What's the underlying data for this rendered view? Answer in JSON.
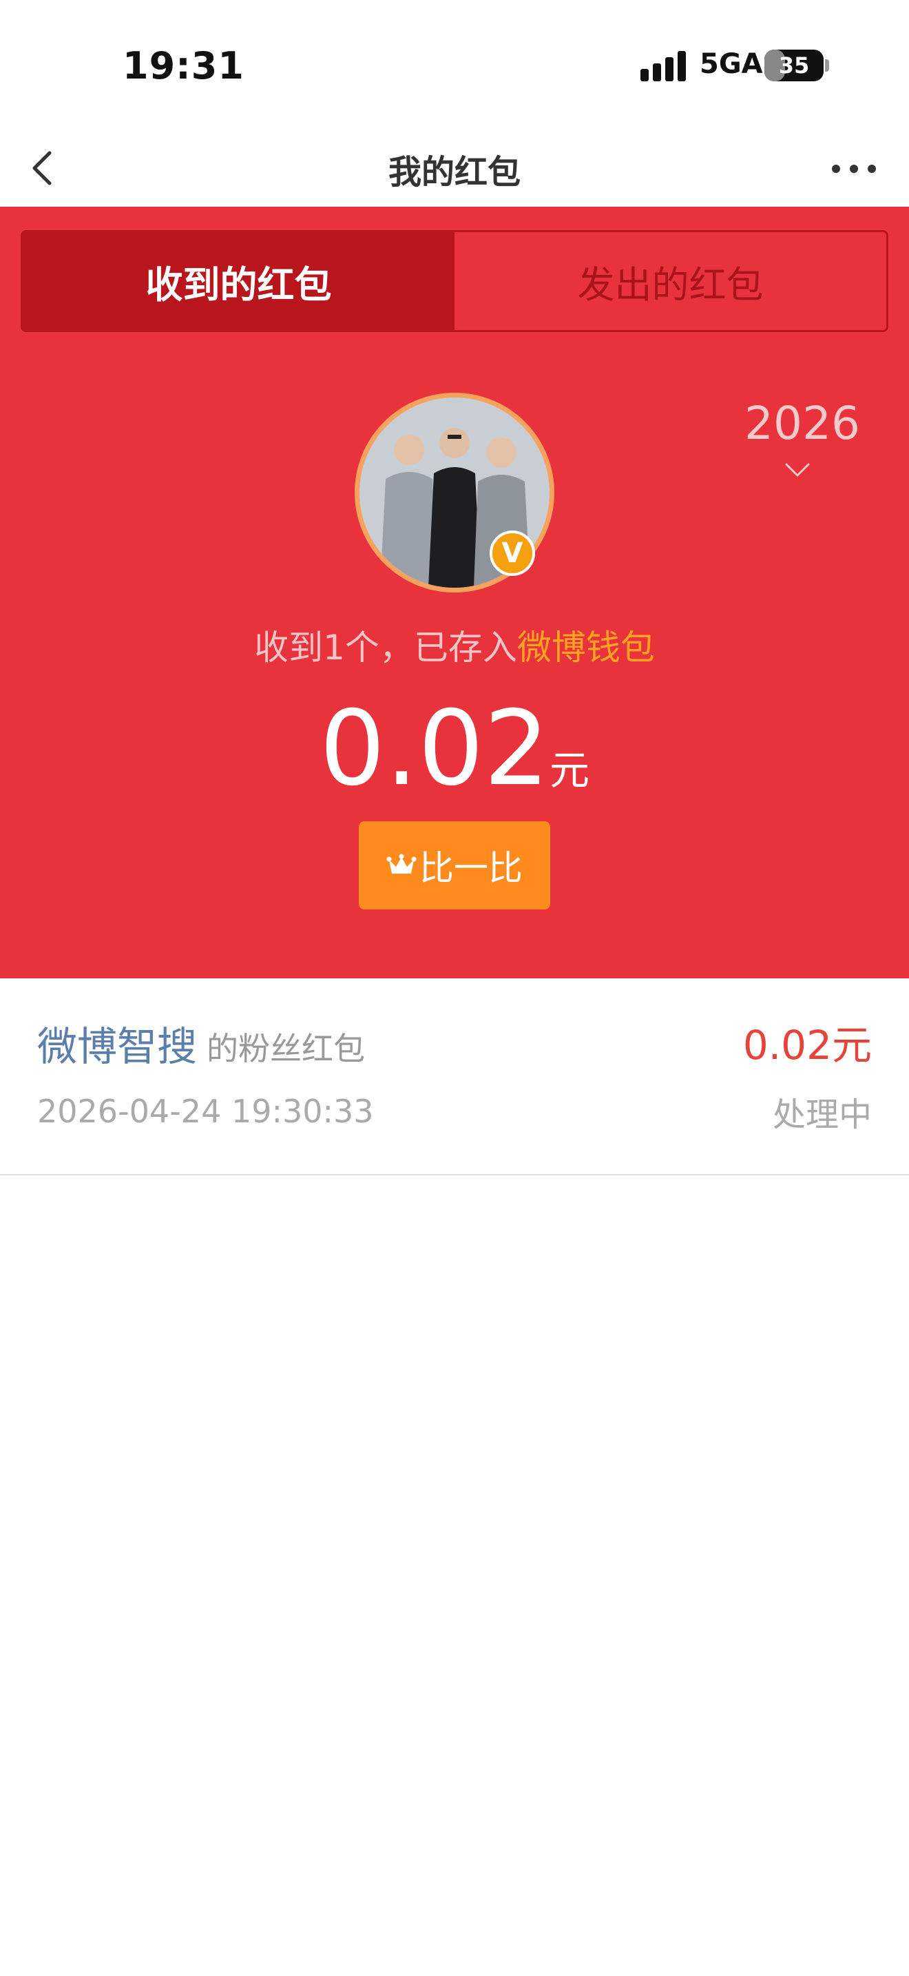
{
  "status_bar": {
    "time": "19:31",
    "network": "5GA",
    "battery": "35",
    "battery_level": 0.35
  },
  "nav": {
    "title": "我的红包",
    "back_icon": "chevron-left-icon",
    "more_icon": "more-horizontal-icon"
  },
  "tabs": [
    {
      "label": "收到的红包",
      "active": true
    },
    {
      "label": "发出的红包",
      "active": false
    }
  ],
  "header": {
    "year": "2026",
    "verified_badge": "V",
    "received_prefix": "收到1个，已存入",
    "wallet_link": "微博钱包",
    "amount": "0.02",
    "amount_unit": "元",
    "compare_button": "比一比"
  },
  "records": [
    {
      "sender": "微博智搜",
      "type": "的粉丝红包",
      "amount": "0.02元",
      "time": "2026-04-24 19:30:33",
      "status": "处理中"
    }
  ],
  "colors": {
    "header_red": "#e8333d",
    "active_tab": "#b8161c",
    "compare_button": "#ff8a1e",
    "wallet_link": "#ffa321",
    "amount_red": "#e6443a",
    "sender_blue": "#5a7fad"
  }
}
